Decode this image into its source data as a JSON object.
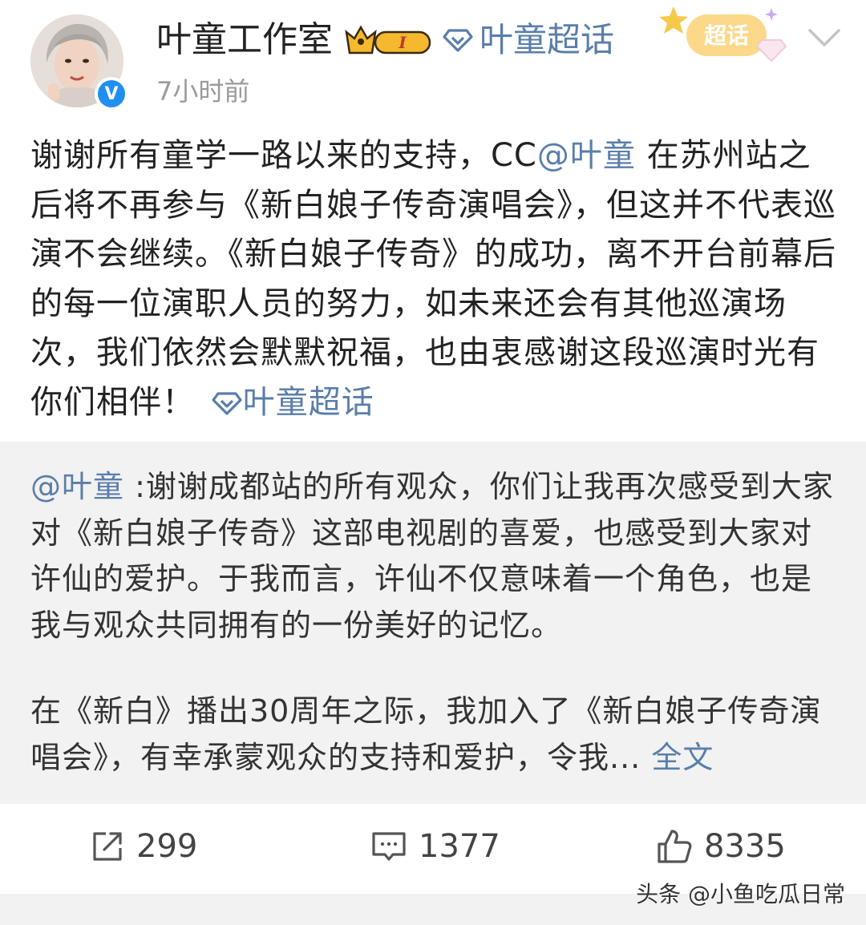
{
  "post": {
    "author": "叶童工作室",
    "member_level": "I",
    "topic_link": "叶童超话",
    "chaohua_badge": "超话",
    "timestamp": "7小时前",
    "text": {
      "part1": "谢谢所有童学一路以来的支持，CC",
      "mention": "@叶童",
      "part2": " 在苏州站之后将不再参与《新白娘子传奇演唱会》，但这并不代表巡演不会继续。《新白娘子传奇》的成功，离不开台前幕后的每一位演职人员的努力，如未来还会有其他巡演场次，我们依然会默默祝福，也由衷感谢这段巡演时光有你们相伴！",
      "topic": "叶童超话"
    }
  },
  "retweet": {
    "mention": "@叶童",
    "para1": " :谢谢成都站的所有观众，你们让我再次感受到大家对《新白娘子传奇》这部电视剧的喜爱，也感受到大家对许仙的爱护。于我而言，许仙不仅意味着一个角色，也是我与观众共同拥有的一份美好的记忆。",
    "para2": "在《新白》播出30周年之际，我加入了《新白娘子传奇演唱会》，有幸承蒙观众的支持和爱护，令我... ",
    "full_text_link": "全文"
  },
  "actions": {
    "repost_count": "299",
    "comment_count": "1377",
    "like_count": "8335"
  },
  "watermark": "头条 @小鱼吃瓜日常",
  "colors": {
    "link": "#5a7eaa",
    "retweet_bg": "#f2f2f2",
    "verified": "#1f8ff0",
    "badge_gold": "#f5b82e"
  }
}
